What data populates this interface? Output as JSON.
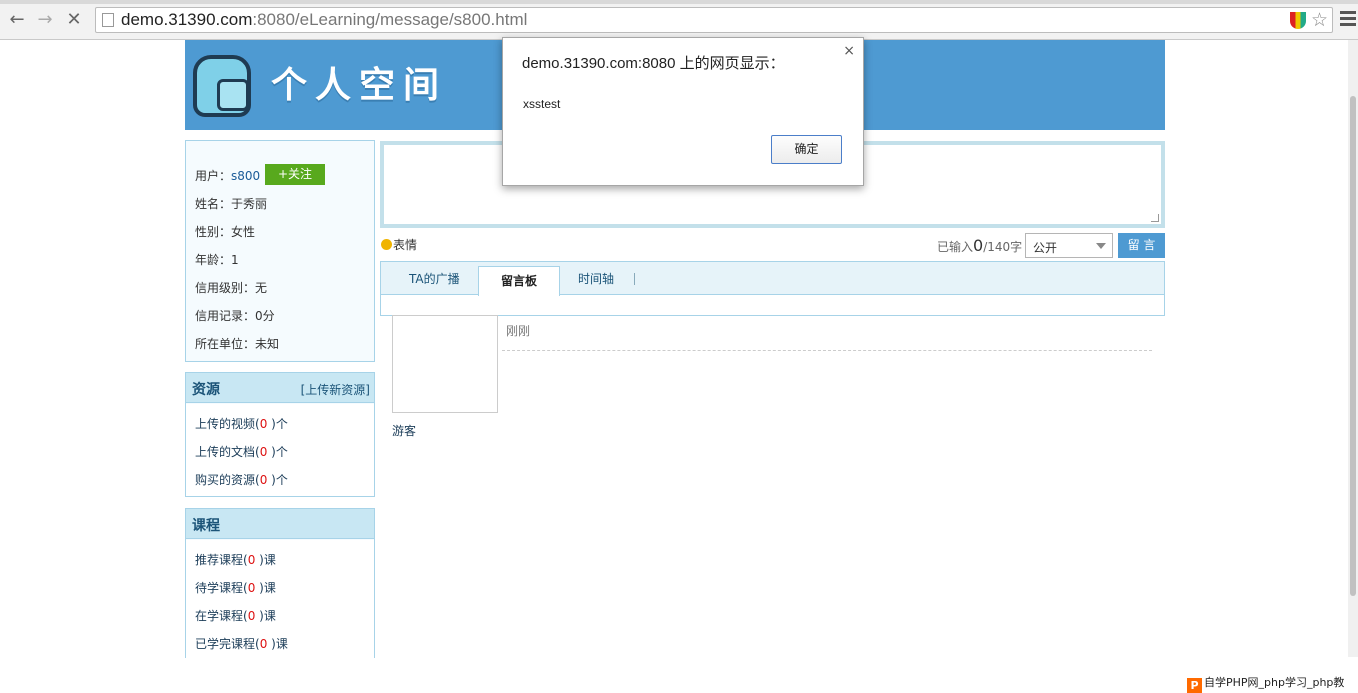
{
  "browser": {
    "url_host": "demo.31390.com",
    "url_rest": ":8080/eLearning/message/s800.html"
  },
  "header": {
    "title": "个人空间"
  },
  "profile": {
    "user_label": "用户：",
    "user_value": "s800",
    "follow_label": "+关注",
    "rows": [
      {
        "label": "姓名：",
        "value": "于秀丽"
      },
      {
        "label": "性别：",
        "value": "女性"
      },
      {
        "label": "年龄：",
        "value": "1"
      },
      {
        "label": "信用级别：",
        "value": "无"
      },
      {
        "label": "信用记录：",
        "value": "0分"
      },
      {
        "label": "所在单位：",
        "value": "未知"
      }
    ]
  },
  "resources": {
    "title": "资源",
    "upload_link": "[上传新资源]",
    "items": [
      {
        "label": "上传的视频(",
        "count": "0",
        "suffix": " )个"
      },
      {
        "label": "上传的文档(",
        "count": "0",
        "suffix": " )个"
      },
      {
        "label": "购买的资源(",
        "count": "0",
        "suffix": " )个"
      }
    ]
  },
  "courses": {
    "title": "课程",
    "items": [
      {
        "label": "推荐课程(",
        "count": "0",
        "suffix": " )课"
      },
      {
        "label": "待学课程(",
        "count": "0",
        "suffix": " )课"
      },
      {
        "label": "在学课程(",
        "count": "0",
        "suffix": " )课"
      },
      {
        "label": "已学完课程(",
        "count": "0",
        "suffix": " )课"
      }
    ]
  },
  "composer": {
    "emoji_label": "表情",
    "counter_prefix": "已输入",
    "counter_value": "0",
    "counter_suffix": "/140字",
    "visibility": "公开",
    "post_label": "留 言"
  },
  "tabs": {
    "items": [
      "TA的广播",
      "留言板",
      "时间轴"
    ],
    "active": "留言板"
  },
  "message": {
    "author": "游客",
    "time": "刚刚"
  },
  "dialog": {
    "title": "demo.31390.com:8080 上的网页显示：",
    "message": "xsstest",
    "ok_label": "确定",
    "close_glyph": "×"
  },
  "watermark": {
    "logo": "P",
    "text": "自学PHP网_php学习_php教"
  }
}
